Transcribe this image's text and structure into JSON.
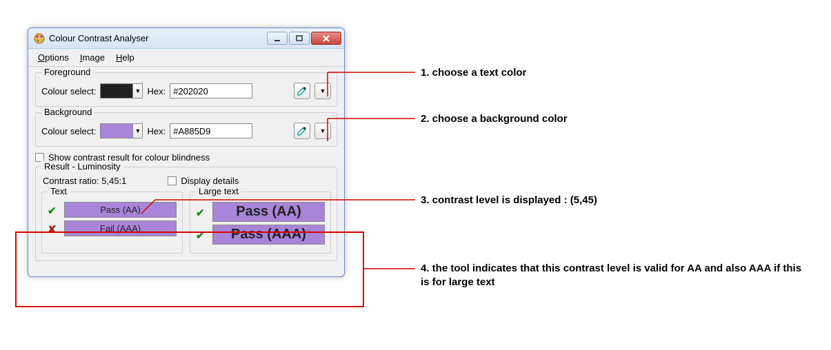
{
  "window": {
    "title": "Colour Contrast Analyser"
  },
  "menu": {
    "options": "Options",
    "image": "Image",
    "help": "Help"
  },
  "foreground": {
    "group_label": "Foreground",
    "colour_select_label": "Colour select:",
    "hex_label": "Hex:",
    "hex_value": "#202020",
    "swatch_color": "#202020"
  },
  "background": {
    "group_label": "Background",
    "colour_select_label": "Colour select:",
    "hex_label": "Hex:",
    "hex_value": "#A885D9",
    "swatch_color": "#A885D9"
  },
  "show_blindness_label": "Show contrast result for colour blindness",
  "result": {
    "group_label": "Result - Luminosity",
    "contrast_label": "Contrast ratio: 5,45:1",
    "display_details_label": "Display details",
    "text_group_label": "Text",
    "large_text_group_label": "Large text",
    "text_aa": "Pass (AA)",
    "text_aaa": "Fail (AAA)",
    "large_aa": "Pass (AA)",
    "large_aaa": "Pass (AAA)",
    "box_bg": "#A885D9"
  },
  "annotations": {
    "a1": "1. choose a text color",
    "a2": "2. choose a background color",
    "a3": "3. contrast level is displayed : (5,45)",
    "a4": "4. the tool indicates that this contrast level is valid for AA and also AAA if this is for large text"
  }
}
